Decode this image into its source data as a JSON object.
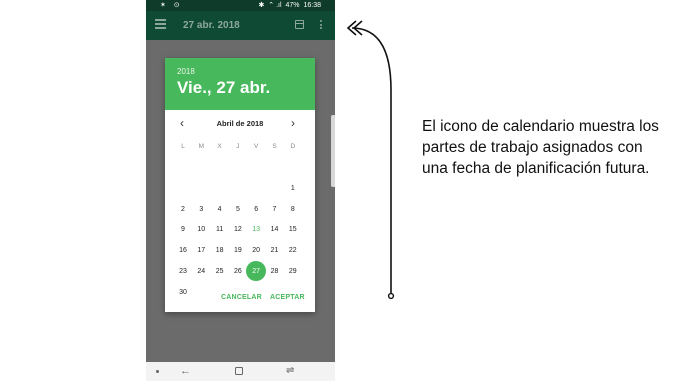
{
  "status_bar": {
    "left_icons": "✶ ⊙",
    "bluetooth": "✱",
    "signal": "⌃ .ıl",
    "battery": "47%",
    "time": "16:38"
  },
  "app_bar": {
    "title": "27 abr. 2018"
  },
  "dialog": {
    "year": "2018",
    "selected_date": "Vie., 27 abr.",
    "month_label": "Abril de 2018",
    "prev_symbol": "‹",
    "next_symbol": "›",
    "weekdays": [
      "L",
      "M",
      "X",
      "J",
      "V",
      "S",
      "D"
    ],
    "weeks": [
      [
        "",
        "",
        "",
        "",
        "",
        "",
        "1"
      ],
      [
        "2",
        "3",
        "4",
        "5",
        "6",
        "7",
        "8"
      ],
      [
        "9",
        "10",
        "11",
        "12",
        "13",
        "14",
        "15"
      ],
      [
        "16",
        "17",
        "18",
        "19",
        "20",
        "21",
        "22"
      ],
      [
        "23",
        "24",
        "25",
        "26",
        "27",
        "28",
        "29"
      ],
      [
        "30",
        "",
        "",
        "",
        "",
        "",
        ""
      ]
    ],
    "today_day": "13",
    "selected_day": "27",
    "cancel_label": "CANCELAR",
    "accept_label": "ACEPTAR"
  },
  "nav_bar": {
    "back_symbol": "←",
    "recent_symbol": "⇌"
  },
  "annotation": {
    "text": "El icono de calendario muestra los partes de trabajo asignados con una fecha de planificación futura."
  },
  "colors": {
    "app_bar": "#0e4a34",
    "accent": "#48b85c",
    "overlay": "#6b6b6b"
  }
}
